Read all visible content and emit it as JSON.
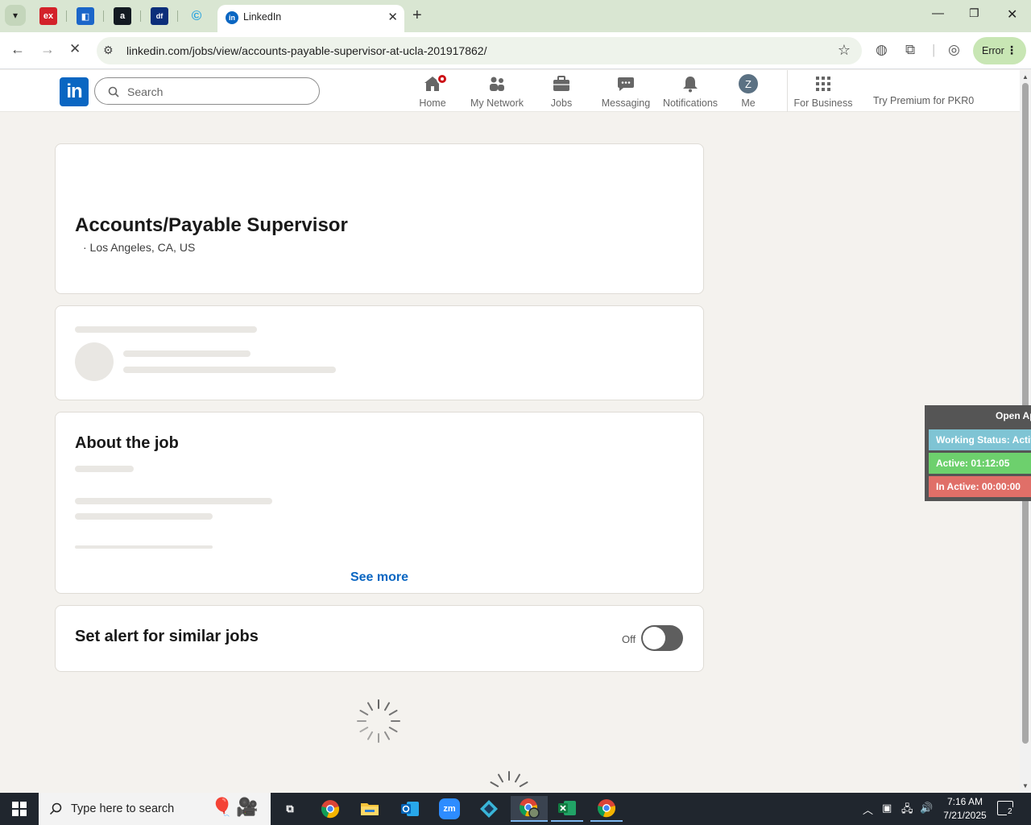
{
  "browser": {
    "pinned_tabs": [
      {
        "name": "ex",
        "color": "#d3222a"
      },
      {
        "name": "a-blue",
        "color": "#1b66c9"
      },
      {
        "name": "amazon",
        "color": "#131a22"
      },
      {
        "name": "df",
        "color": "#0b2e7a"
      },
      {
        "name": "copyright",
        "color": "#2aa4e0"
      }
    ],
    "active_tab_title": "LinkedIn",
    "url": "linkedin.com/jobs/view/accounts-payable-supervisor-at-ucla-201917862/",
    "profile_status": "Error"
  },
  "linkedin": {
    "search_placeholder": "Search",
    "nav": {
      "home": "Home",
      "network": "My Network",
      "jobs": "Jobs",
      "messaging": "Messaging",
      "notifications": "Notifications",
      "me": "Me",
      "avatar_initial": "Z",
      "business": "For Business",
      "premium": "Try Premium for PKR0"
    },
    "job": {
      "title": "Accounts/Payable Supervisor",
      "location": "·  Los Angeles, CA, US"
    },
    "about": {
      "heading": "About the job",
      "see_more": "See more"
    },
    "alert": {
      "heading": "Set alert for similar jobs",
      "toggle_label": "Off",
      "toggle_on": false
    }
  },
  "extension": {
    "open_label": "Open Ap",
    "working_status": "Working Status: Activ",
    "active": "Active: 01:12:05",
    "inactive": "In Active: 00:00:00",
    "colors": {
      "working": "#7fc4d4",
      "active": "#6dd06d",
      "inactive": "#e06f68"
    }
  },
  "taskbar": {
    "search_placeholder": "Type here to search",
    "apps": [
      "task-view",
      "chrome",
      "file-explorer",
      "outlook",
      "zoom",
      "app-diamond",
      "chrome-profile",
      "excel",
      "chrome-2"
    ],
    "time": "7:16 AM",
    "date": "7/21/2025",
    "notification_count": "2"
  }
}
